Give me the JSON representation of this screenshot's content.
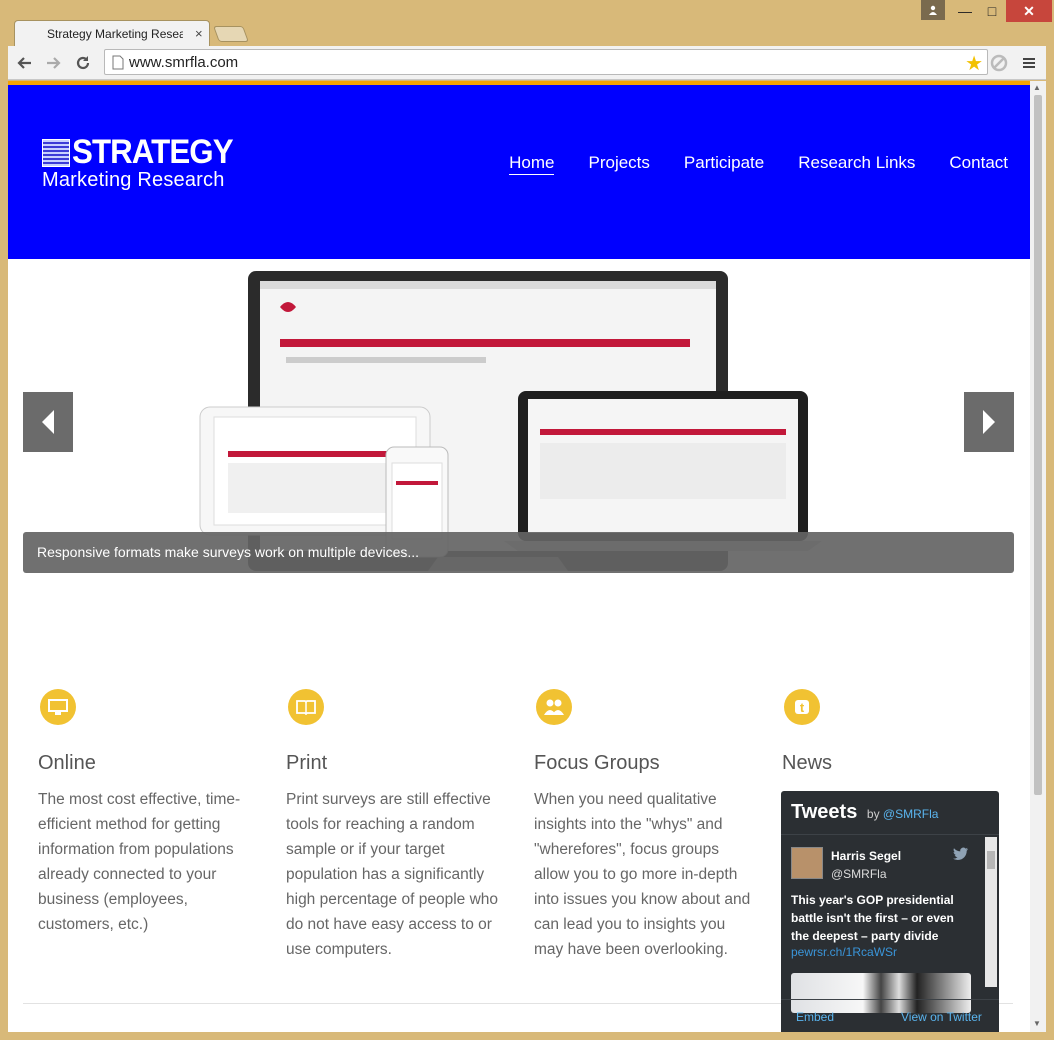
{
  "browser": {
    "tab_title": "Strategy Marketing Resea",
    "tab_close": "×",
    "url": "www.smrfla.com",
    "window_min": "—",
    "window_max": "□",
    "window_close": "✕"
  },
  "site": {
    "logo_title": "STRATEGY",
    "logo_subtitle": "Marketing Research",
    "nav": [
      "Home",
      "Projects",
      "Participate",
      "Research Links",
      "Contact"
    ]
  },
  "slider": {
    "caption": "Responsive formats make surveys work on multiple devices..."
  },
  "features": [
    {
      "icon": "monitor-icon",
      "title": "Online",
      "text": "The most cost effective, time-efficient method for getting information from populations already connected to your business (employees, customers, etc.)"
    },
    {
      "icon": "book-icon",
      "title": "Print",
      "text": "Print surveys are still effective tools for reaching a random sample or if your target population has a significantly high percentage of people who do not have easy access to or use computers."
    },
    {
      "icon": "users-icon",
      "title": "Focus Groups",
      "text": "When you need qualitative insights into the \"whys\" and \"wherefores\", focus groups allow you to go more in-depth into issues you know about and can lead you to insights you may have been overlooking."
    },
    {
      "icon": "tumblr-icon",
      "title": "News",
      "text": ""
    }
  ],
  "twitter": {
    "title": "Tweets",
    "by": "by",
    "handle": "@SMRFla",
    "tweet_name": "Harris Segel",
    "tweet_user": "@SMRFla",
    "tweet_text": "This year's GOP presidential battle isn't the first – or even the deepest – party divide",
    "tweet_link": "pewrsr.ch/1RcaWSr",
    "embed": "Embed",
    "view_on": "View on Twitter"
  },
  "colors": {
    "header_blue": "#0000ff",
    "accent_orange": "#f5a300",
    "icon_yellow": "#f1c232",
    "twitter_link": "#5ab4ee"
  }
}
